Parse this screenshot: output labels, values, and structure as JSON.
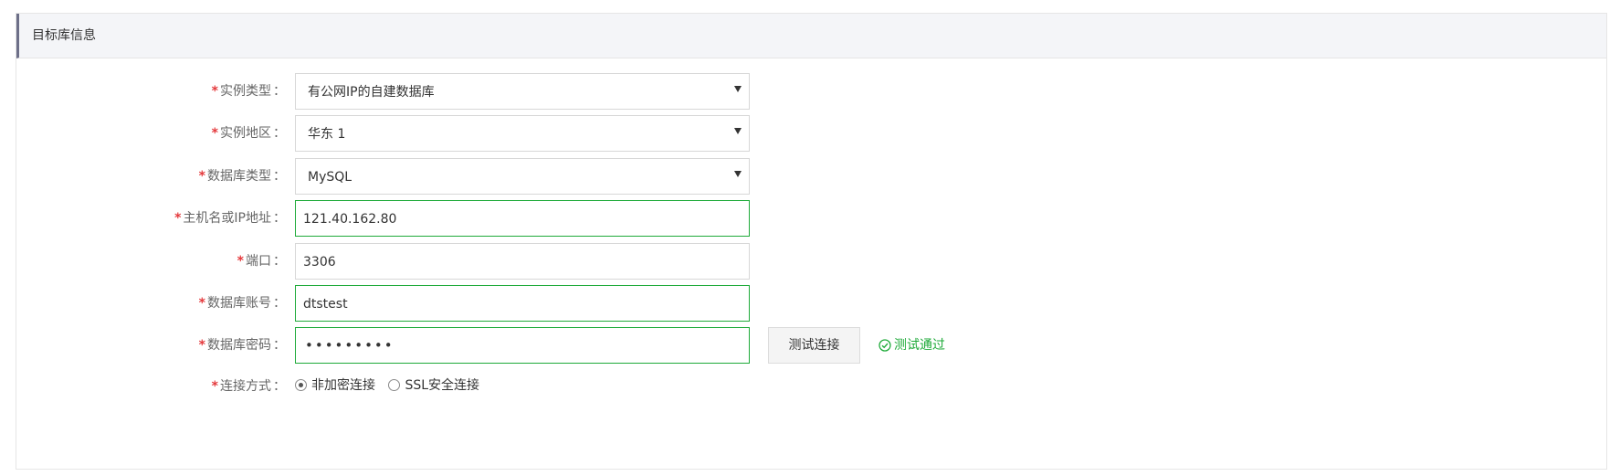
{
  "panel": {
    "title": "目标库信息"
  },
  "fields": {
    "instance_type": {
      "label": "实例类型",
      "value": "有公网IP的自建数据库"
    },
    "instance_region": {
      "label": "实例地区",
      "value": "华东 1"
    },
    "db_type": {
      "label": "数据库类型",
      "value": "MySQL"
    },
    "host": {
      "label": "主机名或IP地址",
      "value": "121.40.162.80"
    },
    "port": {
      "label": "端口",
      "value": "3306"
    },
    "account": {
      "label": "数据库账号",
      "value": "dtstest"
    },
    "password": {
      "label": "数据库密码",
      "masked_value": "•••••••••"
    },
    "connection_method": {
      "label": "连接方式",
      "options": [
        {
          "label": "非加密连接",
          "selected": true
        },
        {
          "label": "SSL安全连接",
          "selected": false
        }
      ]
    }
  },
  "required_marker": "*",
  "label_suffix": "：",
  "test_button": {
    "label": "测试连接"
  },
  "test_status": {
    "text": "测试通过",
    "icon": "check-circle-icon",
    "color": "#1eaa39"
  },
  "colors": {
    "required": "#e4393c",
    "valid_border": "#1eaa39",
    "header_accent": "#6d6f88"
  }
}
